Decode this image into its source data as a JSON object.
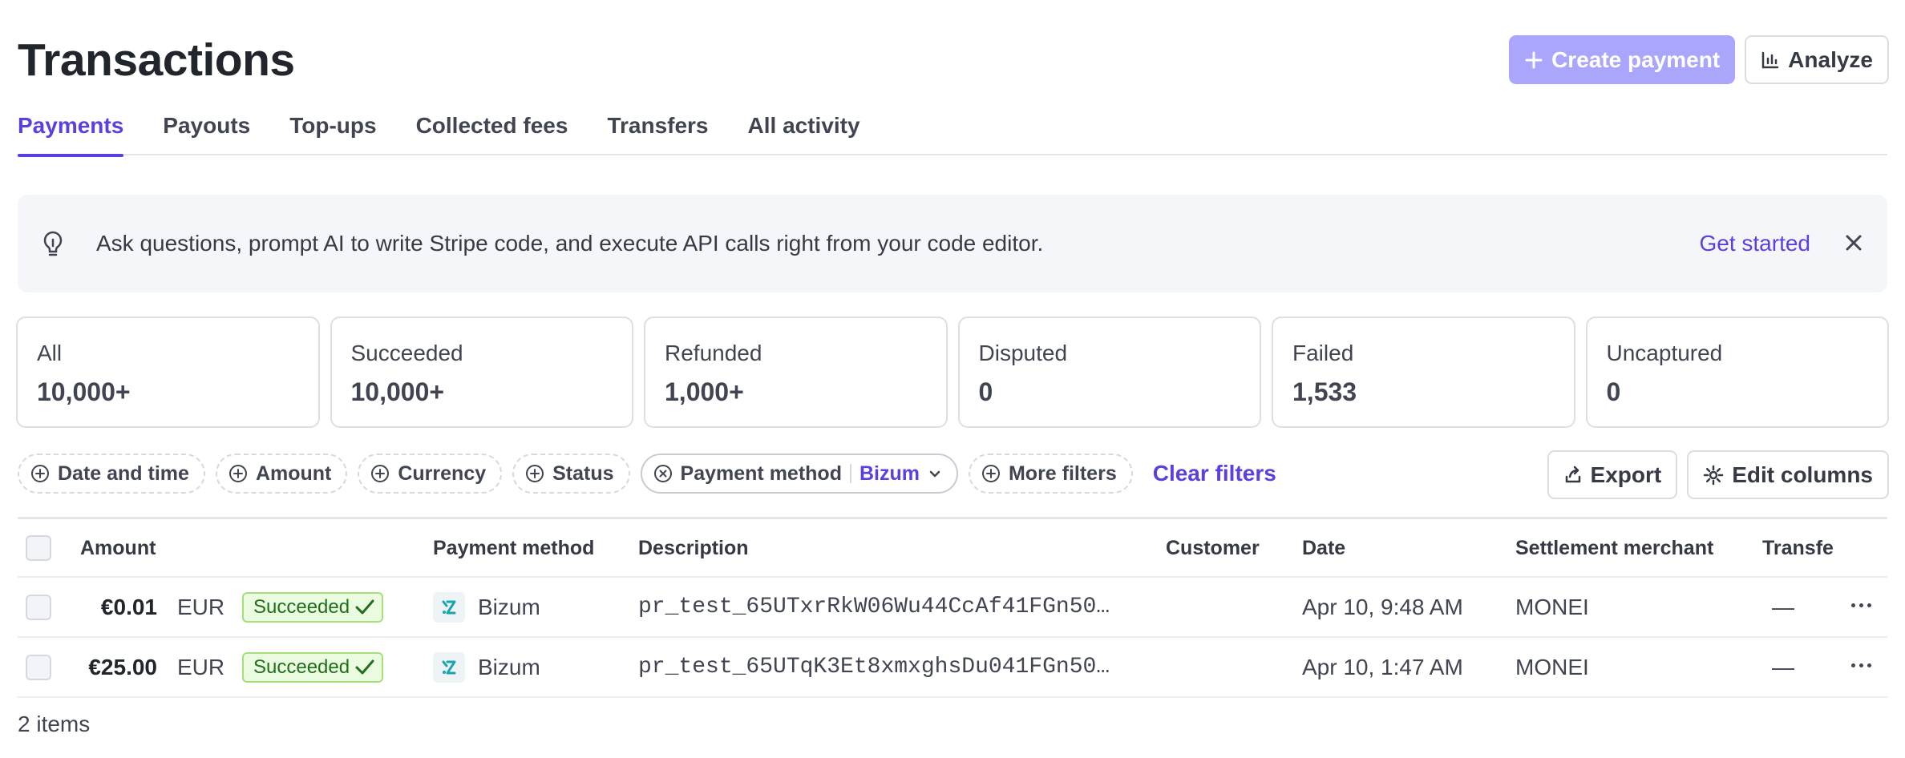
{
  "header": {
    "title": "Transactions",
    "create_payment_label": "Create payment",
    "analyze_label": "Analyze"
  },
  "tabs": [
    {
      "label": "Payments",
      "active": true
    },
    {
      "label": "Payouts"
    },
    {
      "label": "Top-ups"
    },
    {
      "label": "Collected fees"
    },
    {
      "label": "Transfers"
    },
    {
      "label": "All activity"
    }
  ],
  "banner": {
    "icon": "lightbulb-icon",
    "text": "Ask questions, prompt AI to write Stripe code, and execute API calls right from your code editor.",
    "link": "Get started"
  },
  "cards": [
    {
      "label": "All",
      "value": "10,000+"
    },
    {
      "label": "Succeeded",
      "value": "10,000+"
    },
    {
      "label": "Refunded",
      "value": "1,000+"
    },
    {
      "label": "Disputed",
      "value": "0"
    },
    {
      "label": "Failed",
      "value": "1,533"
    },
    {
      "label": "Uncaptured",
      "value": "0"
    }
  ],
  "filters": {
    "date_time": "Date and time",
    "amount": "Amount",
    "currency": "Currency",
    "status": "Status",
    "payment_method": "Payment method",
    "payment_method_value": "Bizum",
    "more_filters": "More filters",
    "clear": "Clear filters",
    "export": "Export",
    "edit_columns": "Edit columns"
  },
  "table": {
    "headers": {
      "amount": "Amount",
      "payment_method": "Payment method",
      "description": "Description",
      "customer": "Customer",
      "date": "Date",
      "settlement_merchant": "Settlement merchant",
      "transfer": "Transfe"
    },
    "rows": [
      {
        "amount": "€0.01",
        "currency": "EUR",
        "status": "Succeeded",
        "payment_method": "Bizum",
        "description": "pr_test_65UTxrRkW06Wu44CcAf41FGn50…",
        "customer": "",
        "date": "Apr 10, 9:48 AM",
        "merchant": "MONEI",
        "transfer": "—"
      },
      {
        "amount": "€25.00",
        "currency": "EUR",
        "status": "Succeeded",
        "payment_method": "Bizum",
        "description": "pr_test_65UTqK3Et8xmxghsDu041FGn50…",
        "customer": "",
        "date": "Apr 10, 1:47 AM",
        "merchant": "MONEI",
        "transfer": "—"
      }
    ]
  },
  "footer": {
    "count": "2 items"
  },
  "colors": {
    "accent": "#5b3fe0",
    "primary_button": "#a9a6fb",
    "success_bg": "#eafbe0",
    "success_border": "#a6e07c"
  }
}
